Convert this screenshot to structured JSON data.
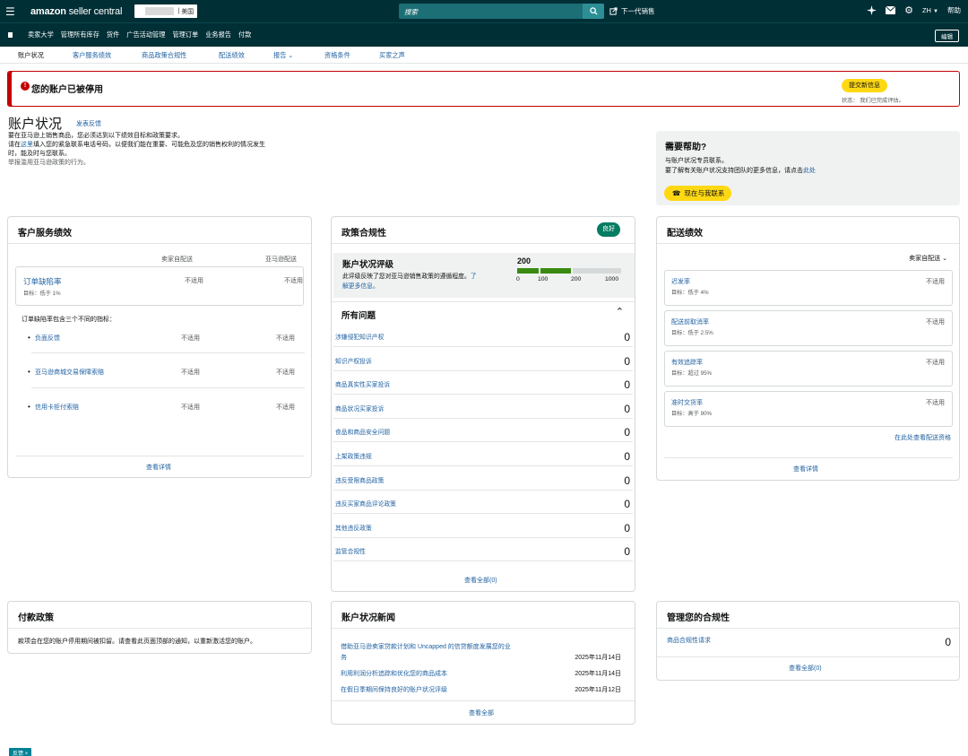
{
  "topbar": {
    "logo_brand": "amazon",
    "logo_product": "seller central",
    "marketplace": "美国",
    "search_placeholder": "搜索",
    "next_gen": "下一代销售",
    "language": "ZH",
    "help": "帮助"
  },
  "nav": {
    "items": [
      "卖家大学",
      "管理所有库存",
      "货件",
      "广告活动管理",
      "管理订单",
      "业务报告",
      "付款"
    ],
    "edit": "编辑"
  },
  "subnav": {
    "items": [
      "账户状况",
      "客户服务绩效",
      "商品政策合规性",
      "配送绩效",
      "报告",
      "资格条件",
      "买家之声"
    ]
  },
  "alert": {
    "title": "您的账户已被停用",
    "submit_button": "提交新信息",
    "status": "状态：  我们已完成评估。"
  },
  "page": {
    "title": "账户状况",
    "feedback": "发表反馈",
    "desc_line1": "要在亚马逊上销售商品，您必须达到以下绩效目标和政策要求。",
    "desc_pre": "请在",
    "desc_link": "这里",
    "desc_line2": "填入您的紧急联系电话号码，以便我们能在重要、可能危及您的销售权利的情况发生",
    "desc_line3": "时，能及时与您联系。",
    "desc_line4": "举报滥用亚马逊政策的行为。"
  },
  "help": {
    "title": "需要帮助?",
    "line1": "与账户状况专员联系。",
    "line2_pre": "要了解有关账户状况支持团队的更多信息，请点击",
    "line2_link": "此处",
    "contact_button": "现在与我联系"
  },
  "csp": {
    "title": "客户服务绩效",
    "col1": "卖家自配送",
    "col2": "亚马逊配送",
    "odr_label": "订单缺陷率",
    "odr_target": "目标：低于 1%",
    "odr_v1": "不适用",
    "odr_v2": "不适用",
    "intro": "订单缺陷率包含三个不同的指标：",
    "metrics": [
      {
        "label": "负面反馈",
        "v1": "不适用",
        "v2": "不适用"
      },
      {
        "label": "亚马逊商城交易保障索赔",
        "v1": "不适用",
        "v2": "不适用"
      },
      {
        "label": "信用卡拒付索赔",
        "v1": "不适用",
        "v2": "不适用"
      }
    ],
    "details": "查看详情"
  },
  "policy": {
    "title": "政策合规性",
    "badge": "良好",
    "rating_title": "账户状况评级",
    "rating_desc1": "此评级反映了您对亚马逊销售政策的遵循程度。",
    "rating_link1": "了",
    "rating_link2": "解更多信息。",
    "rating_value": "200",
    "ticks": [
      "0",
      "100",
      "200",
      "1000"
    ],
    "issues_title": "所有问题",
    "issues": [
      {
        "label": "涉嫌侵犯知识产权",
        "count": "0"
      },
      {
        "label": "知识产权投诉",
        "count": "0"
      },
      {
        "label": "商品真实性买家投诉",
        "count": "0"
      },
      {
        "label": "商品状况买家投诉",
        "count": "0"
      },
      {
        "label": "食品和商品安全问题",
        "count": "0"
      },
      {
        "label": "上架政策违规",
        "count": "0"
      },
      {
        "label": "违反受限商品政策",
        "count": "0"
      },
      {
        "label": "违反买家商品评论政策",
        "count": "0"
      },
      {
        "label": "其他违反政策",
        "count": "0"
      },
      {
        "label": "监管合规性",
        "count": "0"
      }
    ],
    "view_all": "查看全部(0)"
  },
  "shipping": {
    "title": "配送绩效",
    "filter": "卖家自配送",
    "metrics": [
      {
        "label": "迟发率",
        "target": "目标：低于 4%",
        "value": "不适用"
      },
      {
        "label": "配送前取消率",
        "target": "目标：低于 2.5%",
        "value": "不适用"
      },
      {
        "label": "有效追踪率",
        "target": "目标：超过 95%",
        "value": "不适用"
      },
      {
        "label": "准时交货率",
        "target": "目标：高于 90%",
        "value": "不适用"
      }
    ],
    "eligibility": "在此处查看配送资格",
    "details": "查看详情"
  },
  "payment": {
    "title": "付款政策",
    "text": "款项会在您的账户停用期间被扣留。请查看此页面顶部的通知，以重新激活您的账户。"
  },
  "news": {
    "title": "账户状况新闻",
    "items": [
      {
        "line1": "借助亚马逊卖家贷款计划和 Uncapped 的信贷额度发展您的业",
        "line2": "务",
        "date": "2025年11月14日"
      },
      {
        "line1": "利用利润分析追踪和优化您的商品成本",
        "line2": "",
        "date": "2025年11月14日"
      },
      {
        "line1": "在假日季期间保持良好的账户状况评级",
        "line2": "",
        "date": "2025年11月12日"
      }
    ],
    "view_all": "查看全部"
  },
  "manage": {
    "title": "管理您的合规性",
    "item": "商品合规性请求",
    "count": "0",
    "view_all": "查看全部(0)"
  },
  "footer": {
    "feedback": "反馈"
  },
  "colors": {
    "topbar": "#002f36",
    "alert": "#c40000",
    "accent": "#ffd814",
    "good": "#067d62",
    "link": "#2162a1"
  }
}
